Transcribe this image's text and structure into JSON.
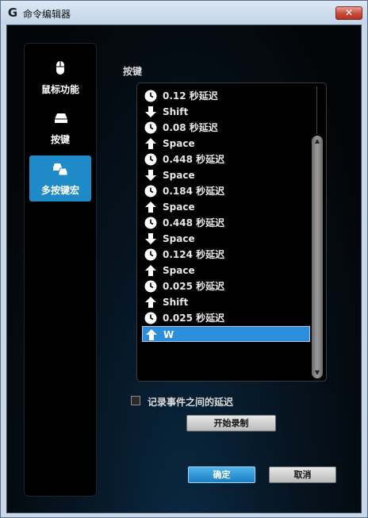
{
  "window": {
    "title": "命令编辑器",
    "close_label": "✕"
  },
  "sidebar": {
    "items": [
      {
        "label": "鼠标功能",
        "icon": "mouse-icon",
        "active": false
      },
      {
        "label": "按键",
        "icon": "key-icon",
        "active": false
      },
      {
        "label": "多按键宏",
        "icon": "multi-key-icon",
        "active": true
      }
    ]
  },
  "main": {
    "section_label": "按键",
    "events": [
      {
        "type": "delay",
        "icon": "clock-icon",
        "text": "0.12 秒延迟"
      },
      {
        "type": "key-down",
        "icon": "arrow-down-icon",
        "text": "Shift"
      },
      {
        "type": "delay",
        "icon": "clock-icon",
        "text": "0.08 秒延迟"
      },
      {
        "type": "key-up",
        "icon": "arrow-up-icon",
        "text": "Space"
      },
      {
        "type": "delay",
        "icon": "clock-icon",
        "text": "0.448 秒延迟"
      },
      {
        "type": "key-down",
        "icon": "arrow-down-icon",
        "text": "Space"
      },
      {
        "type": "delay",
        "icon": "clock-icon",
        "text": "0.184 秒延迟"
      },
      {
        "type": "key-up",
        "icon": "arrow-up-icon",
        "text": "Space"
      },
      {
        "type": "delay",
        "icon": "clock-icon",
        "text": "0.448 秒延迟"
      },
      {
        "type": "key-down",
        "icon": "arrow-down-icon",
        "text": "Space"
      },
      {
        "type": "delay",
        "icon": "clock-icon",
        "text": "0.124 秒延迟"
      },
      {
        "type": "key-up",
        "icon": "arrow-up-icon",
        "text": "Space"
      },
      {
        "type": "delay",
        "icon": "clock-icon",
        "text": "0.025 秒延迟"
      },
      {
        "type": "key-up",
        "icon": "arrow-up-icon",
        "text": "Shift"
      },
      {
        "type": "delay",
        "icon": "clock-icon",
        "text": "0.025 秒延迟"
      },
      {
        "type": "key-up",
        "icon": "arrow-up-icon",
        "text": "W",
        "selected": true
      }
    ],
    "record_delays_label": "记录事件之间的延迟",
    "record_delays_checked": false,
    "start_record_label": "开始录制"
  },
  "footer": {
    "ok_label": "确定",
    "cancel_label": "取消"
  },
  "colors": {
    "accent": "#1e8bc8",
    "selection": "#2d8ede"
  }
}
